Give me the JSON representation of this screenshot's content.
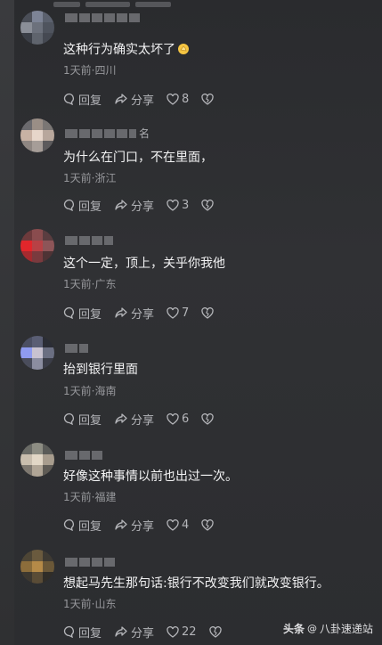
{
  "comments": [
    {
      "text": "这种行为确实太坏了",
      "meta": "1天前·四川",
      "reply_label": "回复",
      "share_label": "分享",
      "likes": "8",
      "username_suffix": "",
      "emoji": "clap-emoji"
    },
    {
      "text": "为什么在门口，不在里面，",
      "meta": "1天前·浙江",
      "reply_label": "回复",
      "share_label": "分享",
      "likes": "3",
      "username_suffix": "名"
    },
    {
      "text": "这个一定，顶上，关乎你我他",
      "meta": "1天前·广东",
      "reply_label": "回复",
      "share_label": "分享",
      "likes": "7",
      "username_suffix": ""
    },
    {
      "text": "抬到银行里面",
      "meta": "1天前·海南",
      "reply_label": "回复",
      "share_label": "分享",
      "likes": "6",
      "username_suffix": ""
    },
    {
      "text": "好像这种事情以前也出过一次。",
      "meta": "1天前·福建",
      "reply_label": "回复",
      "share_label": "分享",
      "likes": "4",
      "username_suffix": ""
    },
    {
      "text": "想起马先生那句话:银行不改变我们就改变银行。",
      "meta": "1天前·山东",
      "reply_label": "回复",
      "share_label": "分享",
      "likes": "22",
      "username_suffix": ""
    }
  ],
  "watermark": {
    "brand": "头条",
    "at": "@",
    "account": "八卦速递站"
  },
  "icons": {
    "reply": "comment-bubble-icon",
    "share": "share-arrow-icon",
    "like": "heart-icon",
    "dislike": "broken-heart-icon"
  },
  "colors": {
    "background": "#2e2f32",
    "text": "#f2f2f3",
    "meta": "#96979b",
    "action": "#b4b5b9"
  }
}
